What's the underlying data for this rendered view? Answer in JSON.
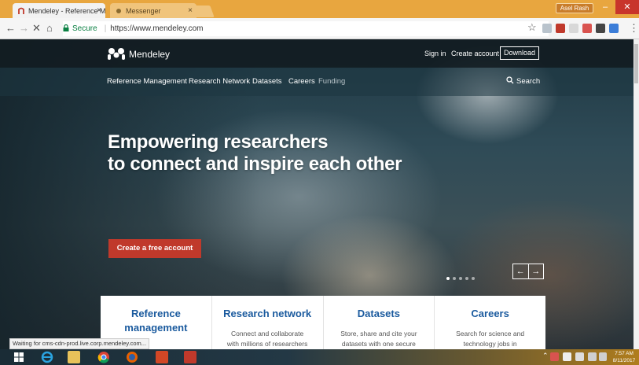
{
  "browser": {
    "tabs": [
      {
        "label": "Mendeley - Reference M",
        "close": "×",
        "active": true
      },
      {
        "label": "Messenger",
        "close": "×",
        "active": false
      }
    ],
    "user_label": "Asel Rash",
    "window_buttons": {
      "minimize": "–",
      "maximize": "❐",
      "close": "✕"
    },
    "nav": {
      "back": "←",
      "forward": "→",
      "reload": "✕",
      "home": "⌂"
    },
    "secure_label": "Secure",
    "url": "https://www.mendeley.com",
    "star": "☆",
    "menu": "⋮"
  },
  "site": {
    "logo_text": "Mendeley",
    "top_links": {
      "sign_in": "Sign in",
      "create_account": "Create account",
      "download": "Download"
    },
    "nav_items": [
      "Reference Management",
      "Research Network",
      "Datasets",
      "Careers",
      "Funding"
    ],
    "search_label": "Search",
    "hero": {
      "line1": "Empowering researchers",
      "line2": "to connect and inspire each other",
      "cta": "Create a free account",
      "arrow_prev": "←",
      "arrow_next": "→",
      "slide_count": 5,
      "active_slide": 1
    },
    "cards": [
      {
        "title_line1": "Reference",
        "title_line2": "management",
        "text1": "",
        "text2": ""
      },
      {
        "title_line1": "Research network",
        "title_line2": "",
        "text1": "Connect and collaborate",
        "text2": "with millions of researchers"
      },
      {
        "title_line1": "Datasets",
        "title_line2": "",
        "text1": "Store, share and cite your",
        "text2": "datasets with one secure"
      },
      {
        "title_line1": "Careers",
        "title_line2": "",
        "text1": "Search for science and",
        "text2": "technology jobs in"
      }
    ]
  },
  "status_text": "Waiting for cms-cdn-prod.live.corp.mendeley.com...",
  "taskbar": {
    "time": "7:57 AM",
    "date": "8/11/2017",
    "tray_symbols": "⌃"
  },
  "colors": {
    "accent_red": "#c0392b",
    "card_title_blue": "#1a5a9e",
    "tab_strip": "#e8a63f"
  }
}
